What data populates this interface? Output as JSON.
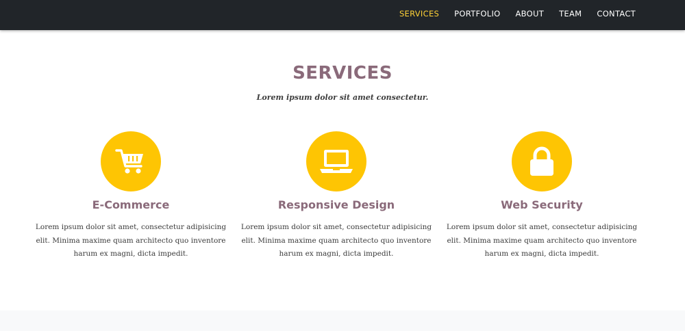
{
  "nav": {
    "items": [
      {
        "label": "SERVICES",
        "active": true
      },
      {
        "label": "PORTFOLIO",
        "active": false
      },
      {
        "label": "ABOUT",
        "active": false
      },
      {
        "label": "TEAM",
        "active": false
      },
      {
        "label": "CONTACT",
        "active": false
      }
    ],
    "active_color": "#fed136"
  },
  "services": {
    "heading": "SERVICES",
    "subheading": "Lorem ipsum dolor sit amet consectetur.",
    "items": [
      {
        "icon": "shopping-cart-icon",
        "title": "E-Commerce",
        "text": "Lorem ipsum dolor sit amet, consectetur adipisicing elit. Minima maxime quam architecto quo inventore harum ex magni, dicta impedit."
      },
      {
        "icon": "laptop-icon",
        "title": "Responsive Design",
        "text": "Lorem ipsum dolor sit amet, consectetur adipisicing elit. Minima maxime quam architecto quo inventore harum ex magni, dicta impedit."
      },
      {
        "icon": "lock-icon",
        "title": "Web Security",
        "text": "Lorem ipsum dolor sit amet, consectetur adipisicing elit. Minima maxime quam architecto quo inventore harum ex magni, dicta impedit."
      }
    ]
  },
  "colors": {
    "navbar_bg": "#212529",
    "accent": "#fec503",
    "heading": "#8a6a7a"
  }
}
